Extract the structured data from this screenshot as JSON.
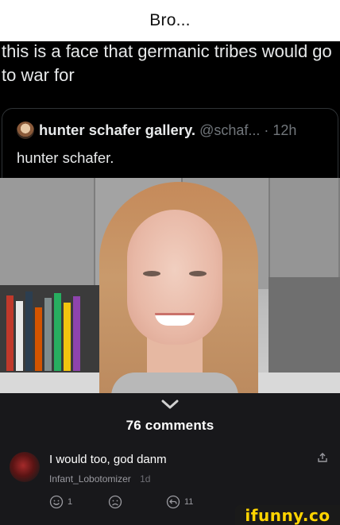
{
  "caption": {
    "text": "Bro..."
  },
  "tweet": {
    "text": "this is a face that germanic tribes would go to war for"
  },
  "quoted_tweet": {
    "display_name": "hunter schafer gallery.",
    "handle_time": "@schaf... · 12h",
    "body": "hunter schafer."
  },
  "photo": {
    "description_icon": "portrait-photo"
  },
  "comments": {
    "count_label": "76 comments",
    "items": [
      {
        "text": "I would too, god danm",
        "username": "Infant_Lobotomizer",
        "time": "1d",
        "likes": "1",
        "replies": "11"
      }
    ]
  },
  "watermark": {
    "text": "ifunny.co"
  },
  "colors": {
    "accent": "#ffd400",
    "comment_bg": "#18181b",
    "tweet_bg": "#000000"
  }
}
